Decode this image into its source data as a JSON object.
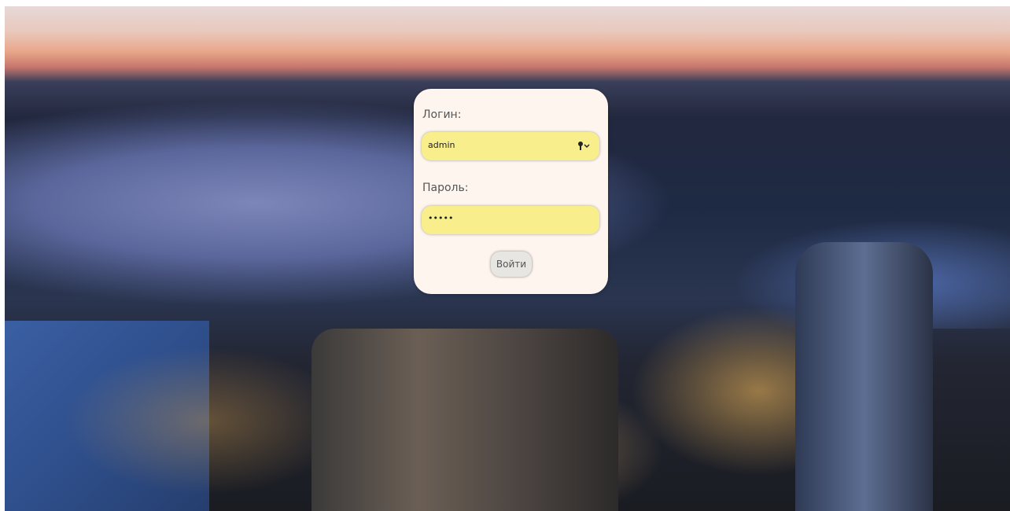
{
  "login_form": {
    "username_label": "Логин:",
    "username_value": "admin",
    "password_label": "Пароль:",
    "password_value": "•••••",
    "submit_label": "Войти"
  },
  "colors": {
    "card_background": "#fdf5ee",
    "input_autofill": "#f8ee8c",
    "button_background": "#e8e6e3"
  },
  "icons": {
    "password_manager": "key-icon"
  }
}
